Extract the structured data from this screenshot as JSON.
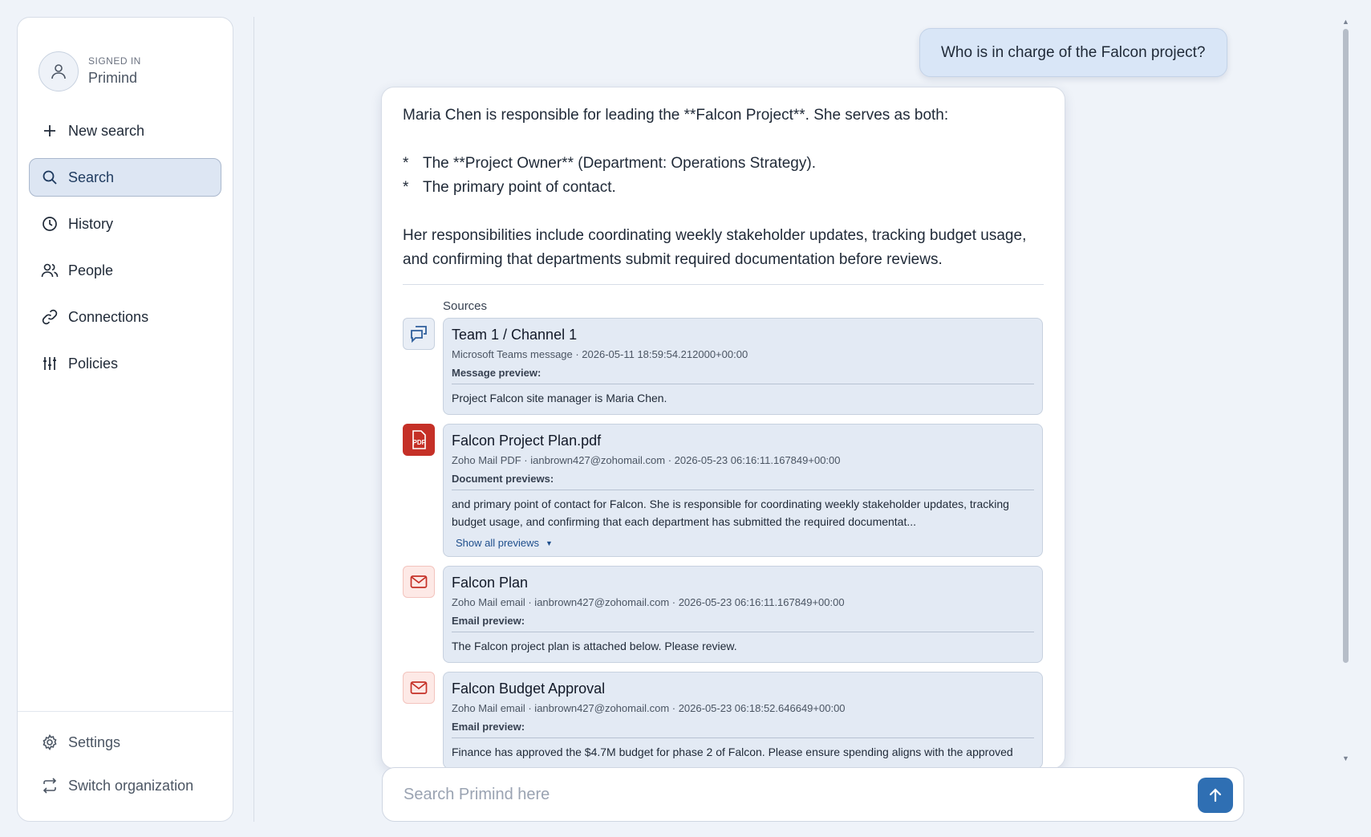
{
  "profile": {
    "signed_in_label": "SIGNED IN",
    "username": "Primind"
  },
  "nav": {
    "new_search": "New search",
    "search": "Search",
    "history": "History",
    "people": "People",
    "connections": "Connections",
    "policies": "Policies"
  },
  "bottom_nav": {
    "settings": "Settings",
    "switch_org": "Switch organization"
  },
  "chat": {
    "user_question": "Who is in charge of the Falcon project?",
    "answer": {
      "intro": "Maria Chen is responsible for leading the **Falcon Project**. She serves as both:",
      "bullet_marker": "*",
      "bullets": [
        "The **Project Owner** (Department: Operations Strategy).",
        "The primary point of contact."
      ],
      "summary": "Her responsibilities include coordinating weekly stakeholder updates, tracking budget usage, and confirming that departments submit required documentation before reviews."
    },
    "sources_label": "Sources",
    "sources": [
      {
        "icon": "teams-chat-icon",
        "title": "Team 1 / Channel 1",
        "meta": "Microsoft Teams message · 2026-05-11 18:59:54.212000+00:00",
        "preview_label": "Message preview:",
        "preview": "Project Falcon site manager is Maria Chen."
      },
      {
        "icon": "pdf-icon",
        "title": "Falcon Project Plan.pdf",
        "meta": "Zoho Mail PDF · ianbrown427@zohomail.com · 2026-05-23 06:16:11.167849+00:00",
        "preview_label": "Document previews:",
        "preview": "and primary point of contact for Falcon. She is responsible for coordinating weekly stakeholder updates, tracking budget usage, and  confirming that each department has submitted the required documentat...",
        "show_all": "Show all previews"
      },
      {
        "icon": "mail-icon",
        "title": "Falcon Plan",
        "meta": "Zoho Mail email · ianbrown427@zohomail.com · 2026-05-23 06:16:11.167849+00:00",
        "preview_label": "Email preview:",
        "preview": "The Falcon project plan is attached below. Please review."
      },
      {
        "icon": "mail-icon",
        "title": "Falcon Budget Approval",
        "meta": "Zoho Mail email · ianbrown427@zohomail.com · 2026-05-23 06:18:52.646649+00:00",
        "preview_label": "Email preview:",
        "preview": "Finance has approved the $4.7M budget for phase 2 of Falcon. Please ensure spending aligns with the approved"
      }
    ]
  },
  "search": {
    "placeholder": "Search Primind here"
  },
  "colors": {
    "accent": "#2f6fb3",
    "active_nav_bg": "#dde6f3",
    "pdf_red": "#c53027"
  }
}
